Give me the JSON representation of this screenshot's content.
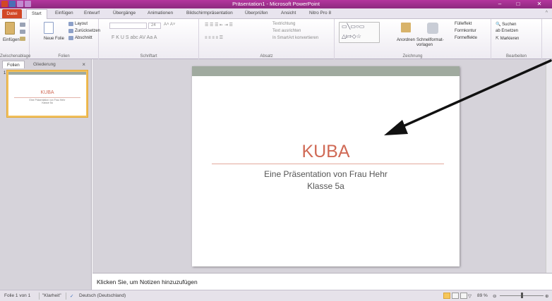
{
  "window": {
    "title": "Präsentation1 - Microsoft PowerPoint",
    "minimize": "–",
    "maximize": "□",
    "close": "✕"
  },
  "ribbon_tabs": [
    "Datei",
    "Start",
    "Einfügen",
    "Entwurf",
    "Übergänge",
    "Animationen",
    "Bildschirmpräsentation",
    "Überprüfen",
    "Ansicht",
    "Nitro Pro 8"
  ],
  "ribbon": {
    "clipboard": {
      "paste": "Einfügen",
      "label": "Zwischenablage"
    },
    "slides": {
      "new_slide": "Neue Folie",
      "layout": "Layout",
      "reset": "Zurücksetzen",
      "section": "Abschnitt",
      "label": "Folien"
    },
    "font": {
      "label": "Schriftart",
      "size": "24"
    },
    "paragraph": {
      "text_direction": "Textrichtung",
      "align_text": "Text ausrichten",
      "smartart": "In SmartArt konvertieren",
      "label": "Absatz"
    },
    "drawing": {
      "arrange": "Anordnen",
      "quick_styles": "Schnellformat-vorlagen",
      "fill": "Fülleffekt",
      "outline": "Formkontur",
      "effects": "Formeffekte",
      "label": "Zeichnung"
    },
    "editing": {
      "find": "Suchen",
      "replace": "Ersetzen",
      "select": "Markieren",
      "label": "Bearbeiten"
    }
  },
  "panel": {
    "tab_slides": "Folien",
    "tab_outline": "Gliederung",
    "close": "×",
    "thumb_number": "1",
    "thumb_title": "KUBA",
    "thumb_sub1": "Eine Präsentation von Frau Hehr",
    "thumb_sub2": "Klasse 5a"
  },
  "slide": {
    "title": "KUBA",
    "subtitle_line1": "Eine Präsentation von Frau Hehr",
    "subtitle_line2": "Klasse 5a"
  },
  "notes": {
    "placeholder": "Klicken Sie, um Notizen hinzuzufügen"
  },
  "status": {
    "slide_info": "Folie 1 von 1",
    "theme": "\"Klarheit\"",
    "language": "Deutsch (Deutschland)",
    "zoom": "89 %"
  },
  "colors": {
    "title_bar": "#8d2a7e",
    "file_tab": "#d24726",
    "slide_title": "#d06a56",
    "slide_bar": "#a0aa9f"
  }
}
